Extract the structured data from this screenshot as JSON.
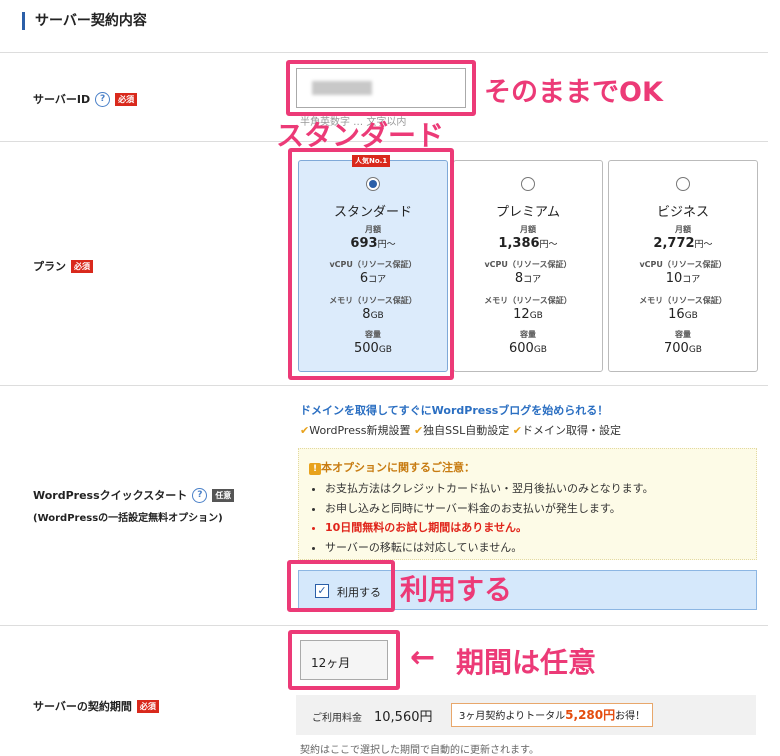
{
  "section_title": "サーバー契約内容",
  "server_id": {
    "label": "サーバーID",
    "help": "?",
    "required": "必須",
    "hint": "半角英数字 … 文字以内",
    "annotation": "そのままでOK"
  },
  "plan": {
    "label": "プラン",
    "required": "必須",
    "annotation": "スタンダード",
    "popular_badge": "人気No.1",
    "spec_labels": {
      "price": "月額",
      "cpu": "vCPU（リソース保証）",
      "memory": "メモリ（リソース保証）",
      "storage": "容量"
    },
    "cards": [
      {
        "name": "スタンダード",
        "price": "693",
        "price_unit": "円〜",
        "cpu": "6",
        "cpu_unit": "コア",
        "memory": "8",
        "memory_unit": "GB",
        "storage": "500",
        "storage_unit": "GB",
        "selected": true
      },
      {
        "name": "プレミアム",
        "price": "1,386",
        "price_unit": "円〜",
        "cpu": "8",
        "cpu_unit": "コア",
        "memory": "12",
        "memory_unit": "GB",
        "storage": "600",
        "storage_unit": "GB",
        "selected": false
      },
      {
        "name": "ビジネス",
        "price": "2,772",
        "price_unit": "円〜",
        "cpu": "10",
        "cpu_unit": "コア",
        "memory": "16",
        "memory_unit": "GB",
        "storage": "700",
        "storage_unit": "GB",
        "selected": false
      }
    ]
  },
  "wp_quick": {
    "label": "WordPressクイックスタート",
    "help": "?",
    "optional": "任意",
    "sub_label": "(WordPressの一括設定無料オプション)",
    "headline": "ドメインを取得してすぐにWordPressブログを始められる！",
    "features": [
      "WordPress新規設置",
      "独自SSL自動設定",
      "ドメイン取得・設定"
    ],
    "check_icon": "✔",
    "notice_title": "本オプションに関するご注意：",
    "notice_icon": "!",
    "notices": [
      "お支払方法はクレジットカード払い・翌月後払いのみとなります。",
      "お申し込みと同時にサーバー料金のお支払いが発生します。",
      "10日間無料のお試し期間はありません。",
      "サーバーの移転には対応していません。"
    ],
    "use_checkbox_label": "利用する",
    "use_checked": true,
    "annotation": "利用する"
  },
  "period": {
    "label": "サーバーの契約期間",
    "required": "必須",
    "selected": "12ヶ月",
    "annotation": "期間は任意",
    "arrow": "←",
    "fee_label": "ご利用料金",
    "fee_amount": "10,560円",
    "promo_prefix": "3ヶ月契約よりトータル",
    "promo_amount": "5,280円",
    "promo_suffix": "お得！",
    "footnote": "契約はここで選択した期間で自動的に更新されます。"
  },
  "colors": {
    "accent_pink": "#ec3a77",
    "required_red": "#d9291c",
    "brand_blue": "#2b5fa8"
  }
}
